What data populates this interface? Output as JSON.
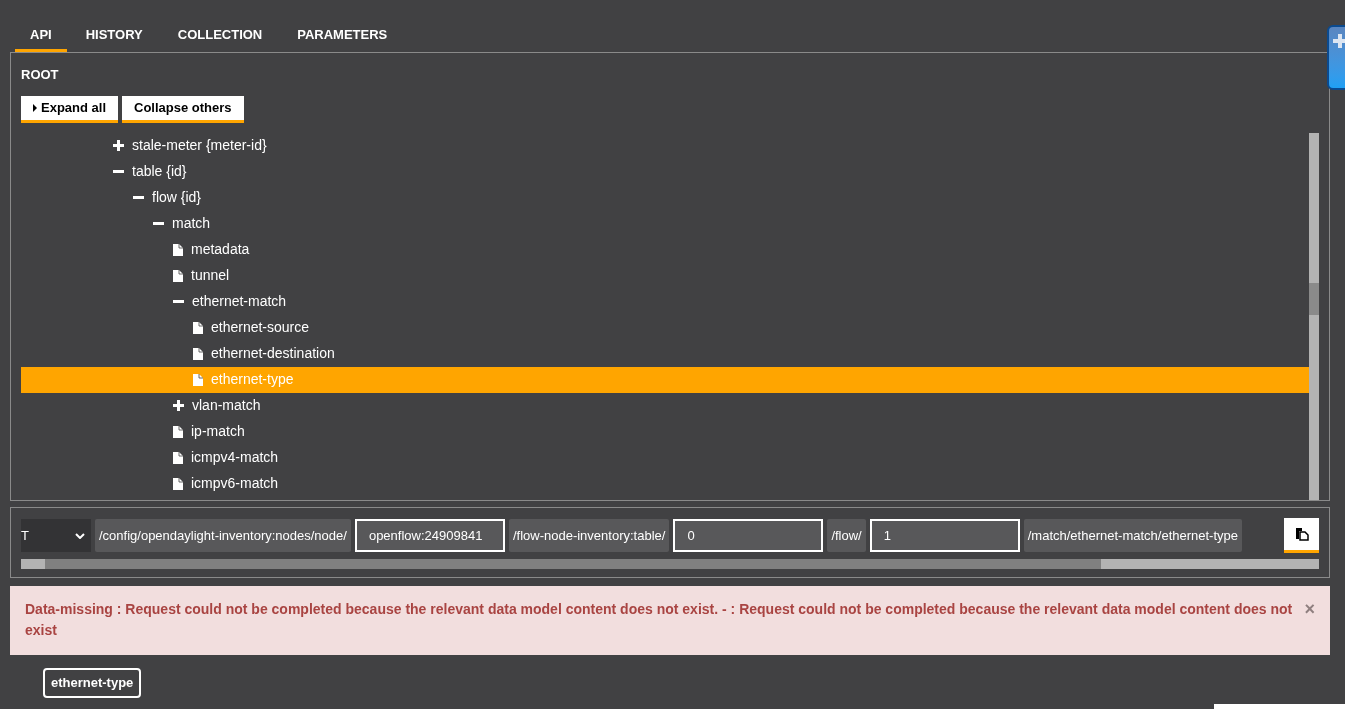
{
  "tabs": [
    {
      "label": "API",
      "selected": true
    },
    {
      "label": "HISTORY",
      "selected": false
    },
    {
      "label": "COLLECTION",
      "selected": false
    },
    {
      "label": "PARAMETERS",
      "selected": false
    }
  ],
  "root_label": "ROOT",
  "tree_buttons": [
    {
      "label": "Expand all",
      "kind": "caret"
    },
    {
      "label": "Collapse others",
      "kind": "plain"
    }
  ],
  "tree": [
    {
      "label": "stale-meter {meter-id}",
      "kind": "branch",
      "expanded": false,
      "selected": false
    },
    {
      "label": "table {id}",
      "kind": "branch",
      "expanded": true,
      "selected": false,
      "children": [
        {
          "label": "flow {id}",
          "kind": "branch",
          "expanded": true,
          "selected": false,
          "children": [
            {
              "label": "match",
              "kind": "branch",
              "expanded": true,
              "selected": false,
              "children": [
                {
                  "label": "metadata",
                  "kind": "leaf",
                  "selected": false
                },
                {
                  "label": "tunnel",
                  "kind": "leaf",
                  "selected": false
                },
                {
                  "label": "ethernet-match",
                  "kind": "branch",
                  "expanded": true,
                  "selected": false,
                  "children": [
                    {
                      "label": "ethernet-source",
                      "kind": "leaf",
                      "selected": false
                    },
                    {
                      "label": "ethernet-destination",
                      "kind": "leaf",
                      "selected": false
                    },
                    {
                      "label": "ethernet-type",
                      "kind": "leaf",
                      "selected": true
                    }
                  ]
                },
                {
                  "label": "vlan-match",
                  "kind": "branch",
                  "expanded": false,
                  "selected": false
                },
                {
                  "label": "ip-match",
                  "kind": "leaf",
                  "selected": false
                },
                {
                  "label": "icmpv4-match",
                  "kind": "leaf",
                  "selected": false
                },
                {
                  "label": "icmpv6-match",
                  "kind": "leaf",
                  "selected": false
                }
              ]
            }
          ]
        }
      ]
    }
  ],
  "method_select": {
    "value": "T"
  },
  "path": [
    {
      "kind": "text",
      "text": "/config/opendaylight-inventory:nodes/node/"
    },
    {
      "kind": "input",
      "value": "openflow:24909841"
    },
    {
      "kind": "text",
      "text": "/flow-node-inventory:table/"
    },
    {
      "kind": "input",
      "value": "0"
    },
    {
      "kind": "text",
      "text": "/flow/"
    },
    {
      "kind": "input",
      "value": "1"
    },
    {
      "kind": "text",
      "text": "/match/ethernet-match/ethernet-type"
    }
  ],
  "alert": {
    "message": "Data-missing : Request could not be completed because the relevant data model content does not exist. - : Request could not be completed because the relevant data model content does not exist",
    "close": "×"
  },
  "tag": "ethernet-type"
}
